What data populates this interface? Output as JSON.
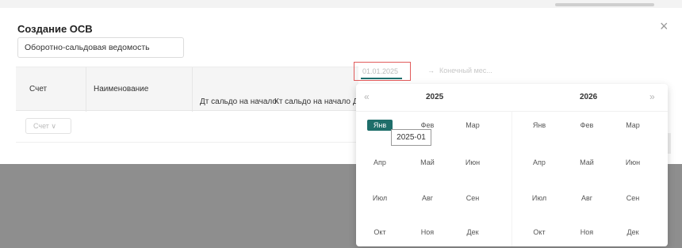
{
  "dialog": {
    "title": "Создание ОСВ",
    "close_glyph": "×",
    "name_value": "Оборотно-сальдовая ведомость"
  },
  "table": {
    "headers": [
      "Счет",
      "Наименование",
      "Дт сальдо на начало",
      "Кт сальдо на начало",
      "Д"
    ],
    "account_filter": "Счет  ∨"
  },
  "range": {
    "start_value": "01.01.2025",
    "arrow": "→",
    "end_placeholder": "Конечный мес..."
  },
  "calendar": {
    "prev_glyph": "«",
    "next_glyph": "»",
    "left_year": "2025",
    "right_year": "2026",
    "left_months": [
      "Янв",
      "Фев",
      "Мар",
      "Апр",
      "Май",
      "Июн",
      "Июл",
      "Авг",
      "Сен",
      "Окт",
      "Ноя",
      "Дек"
    ],
    "right_months": [
      "Янв",
      "Фев",
      "Мар",
      "Апр",
      "Май",
      "Июн",
      "Июл",
      "Авг",
      "Сен",
      "Окт",
      "Ноя",
      "Дек"
    ],
    "selected_month": "Янв 2025",
    "tooltip": "2025-01"
  },
  "colors": {
    "accent": "#1e6e6a",
    "focus_border": "#e15b5b",
    "overlay": "#8e8e8e"
  }
}
